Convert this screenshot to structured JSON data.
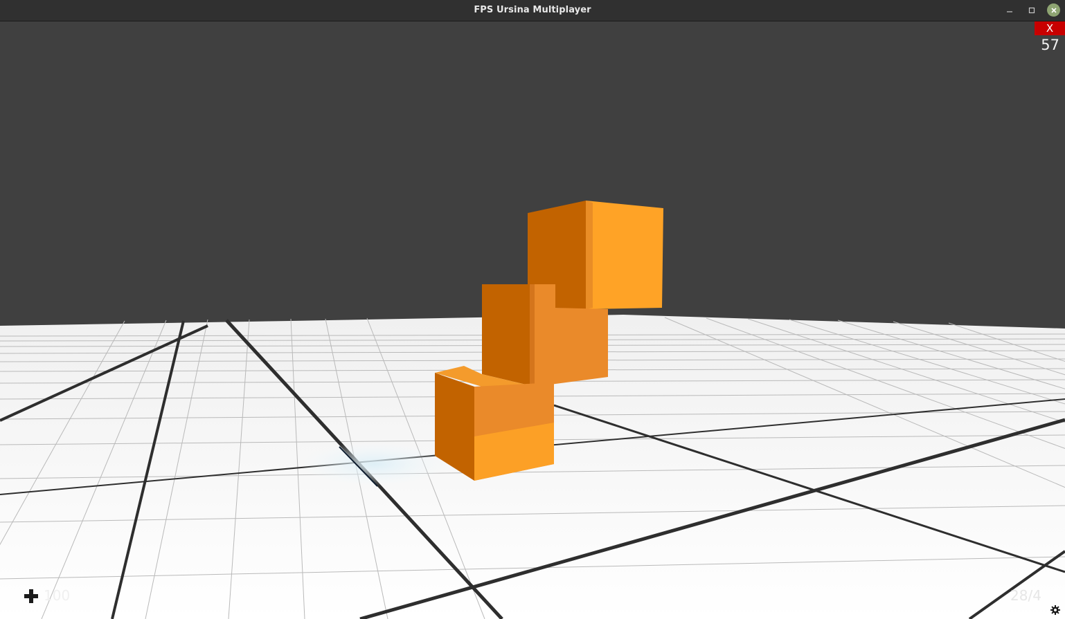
{
  "window": {
    "title": "FPS Ursina Multiplayer",
    "controls": {
      "minimize_icon": "minimize-icon",
      "maximize_icon": "maximize-icon",
      "close_icon": "close-icon"
    }
  },
  "hud": {
    "exit_label": "X",
    "fps": "57",
    "health": {
      "icon": "plus-health-icon",
      "value": "100"
    },
    "ammo": "28/4",
    "settings_icon": "gear-icon"
  },
  "colors": {
    "sky": "#404040",
    "floor": "#ffffff",
    "grid_major": "#2e2e2e",
    "grid_minor": "#b8b8b8",
    "cube_light": "#ffa326",
    "cube_mid": "#ea8a2a",
    "cube_dark": "#c26300",
    "exit_button": "#c80000"
  }
}
